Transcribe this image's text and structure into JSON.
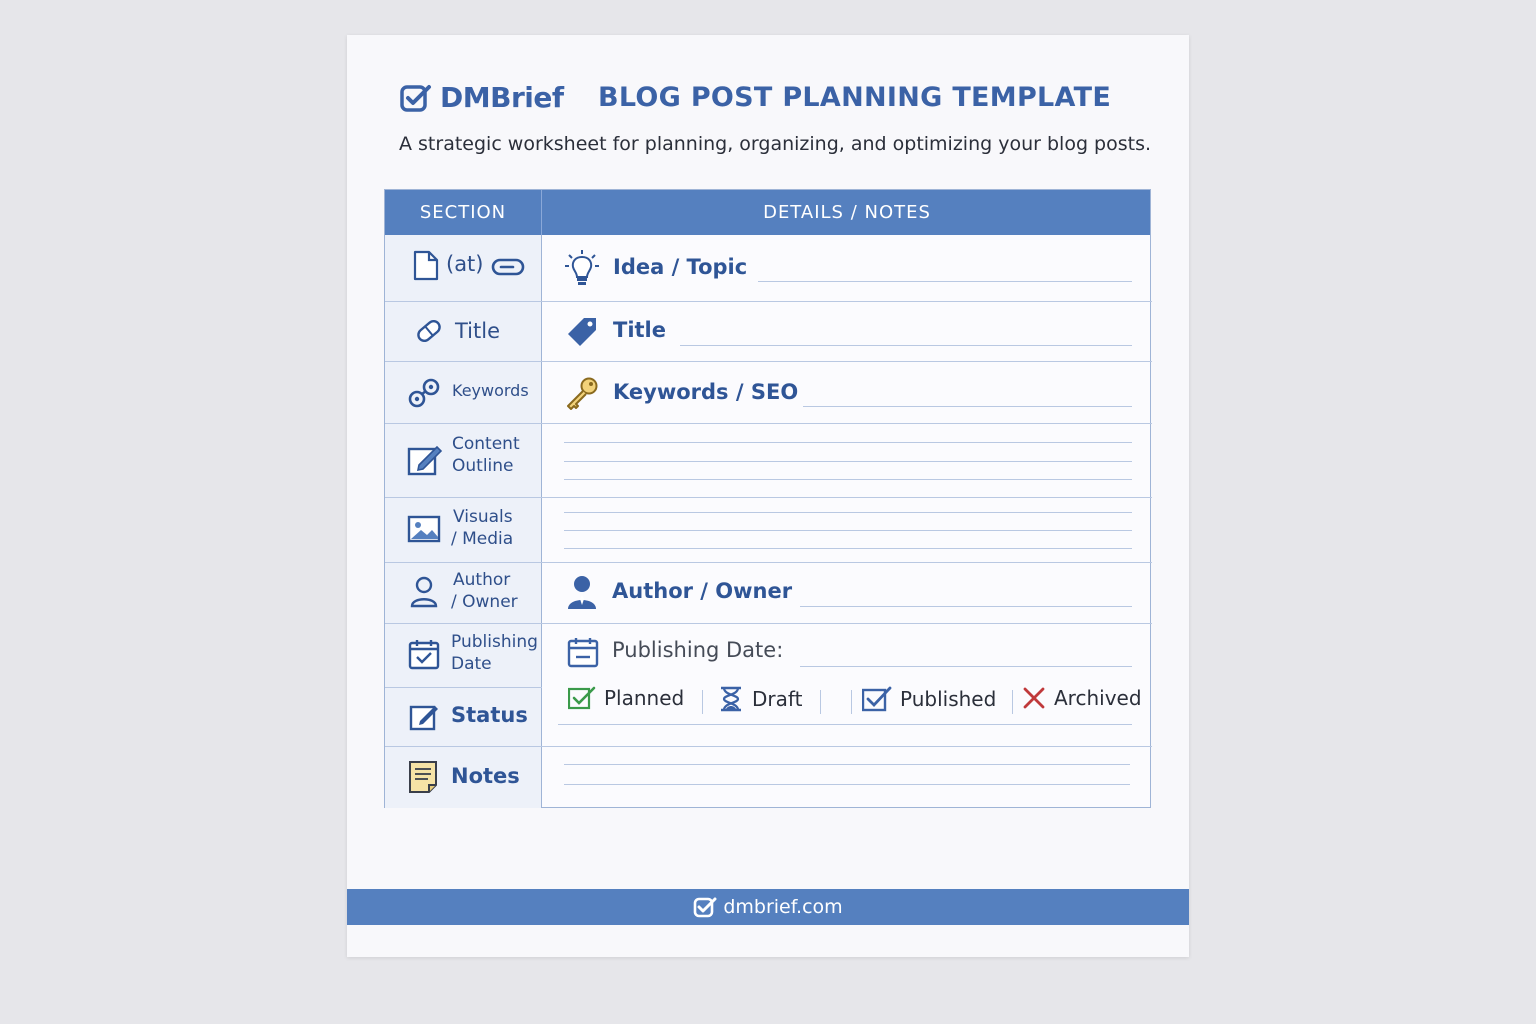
{
  "brand": {
    "name": "DMBrief"
  },
  "document": {
    "title": "BLOG POST PLANNING TEMPLATE",
    "subtitle": "A strategic worksheet for planning, organizing, and optimizing your blog posts."
  },
  "table": {
    "headers": {
      "section": "SECTION",
      "details": "DETAILS / NOTES"
    },
    "sections": {
      "idea_icon_text": "(at)",
      "title": "Title",
      "keywords": "Keywords",
      "content_outline": [
        "Content",
        "Outline"
      ],
      "visuals_media": [
        "Visuals",
        "/ Media"
      ],
      "author_owner": [
        "Author",
        "/ Owner"
      ],
      "publishing_date": [
        "Publishing",
        "Date"
      ],
      "status": "Status",
      "notes": "Notes"
    },
    "details": {
      "idea_topic": "Idea / Topic",
      "title": "Title",
      "keywords_seo": "Keywords / SEO",
      "author_owner": "Author / Owner",
      "publishing_date": "Publishing Date:",
      "status_options": {
        "planned": "Planned",
        "draft": "Draft",
        "published": "Published",
        "archived": "Archived"
      }
    }
  },
  "colors": {
    "accent": "#5580bf",
    "brand_text": "#3b62a6",
    "planned": "#3a9a4a",
    "archived": "#c0393b"
  },
  "footer": {
    "url": "dmbrief.com"
  }
}
